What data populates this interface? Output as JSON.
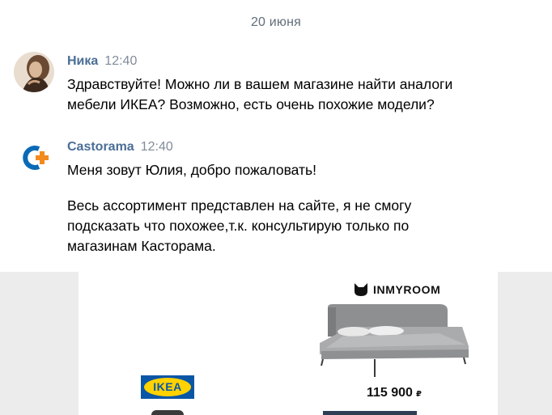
{
  "date_separator": "20 июня",
  "messages": [
    {
      "author": "Ника",
      "time": "12:40",
      "lines": [
        "Здравствуйте! Можно ли в вашем магазине найти аналоги",
        "мебели ИКЕА? Возможно, есть очень похожие модели?"
      ]
    },
    {
      "author": "Castorama",
      "time": "12:40",
      "lines": [
        "Меня зовут Юлия, добро пожаловать!"
      ],
      "lines2": [
        "Весь ассортимент представлен на сайте, я не смогу",
        "подсказать что похожее,т.к. консультирую только по",
        "магазинам Касторама."
      ]
    }
  ],
  "promo": {
    "left_brand": "IKEA",
    "right_brand": "INMYROOM",
    "price": "115 900",
    "currency": "₽"
  },
  "colors": {
    "author": "#4a6e96",
    "castorama_blue": "#0a6ab6",
    "castorama_orange": "#f28a1e",
    "ikea_blue": "#0a56a6",
    "ikea_yellow": "#ffd200"
  }
}
